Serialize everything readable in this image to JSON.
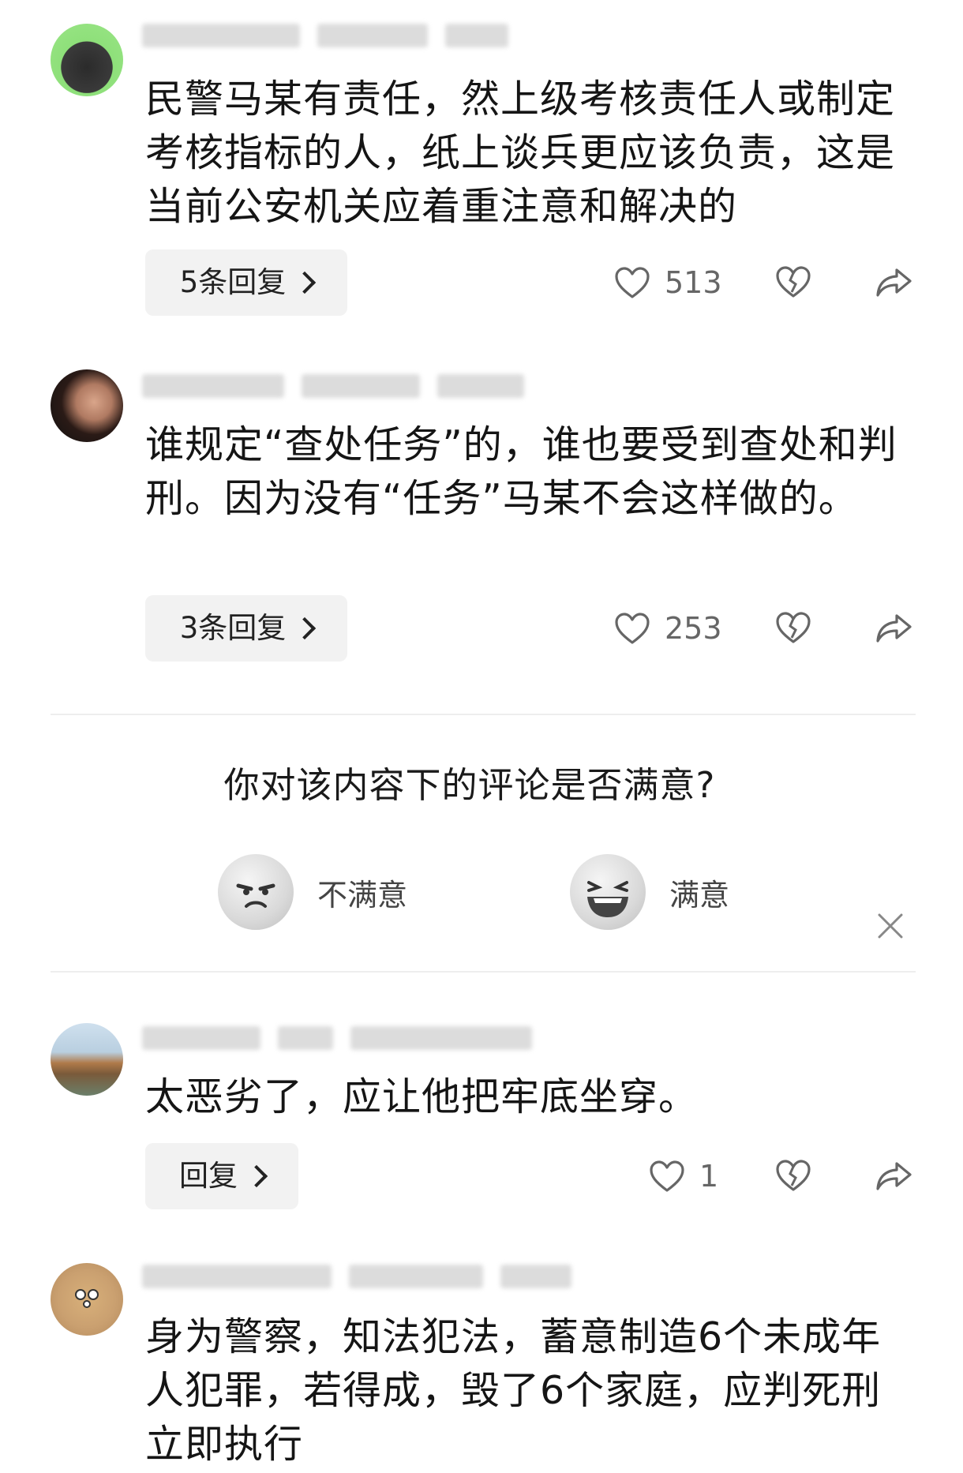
{
  "comments": [
    {
      "text": "民警马某有责任，然上级考核责任人或制定考核指标的人，纸上谈兵更应该负责，这是当前公安机关应着重注意和解决的",
      "replies_label": "5条回复",
      "likes": "513"
    },
    {
      "text": "谁规定“查处任务”的，谁也要受到查处和判刑。因为没有“任务”马某不会这样做的。",
      "replies_label": "3条回复",
      "likes": "253"
    },
    {
      "text": "太恶劣了，应让他把牢底坐穿。",
      "replies_label": "回复",
      "likes": "1"
    },
    {
      "text": "身为警察，知法犯法，蓄意制造6个未成年人犯罪，若得成，毁了6个家庭，应判死刑立即执行"
    }
  ],
  "survey": {
    "question": "你对该内容下的评论是否满意?",
    "unsatisfied_label": "不满意",
    "satisfied_label": "满意"
  },
  "icons": [
    "like-heart-icon",
    "dislike-broken-heart-icon",
    "share-arrow-icon",
    "close-icon",
    "chevron-right-icon"
  ],
  "colors": {
    "text": "#151515",
    "muted": "#666666",
    "button_bg": "#f2f2f2"
  }
}
